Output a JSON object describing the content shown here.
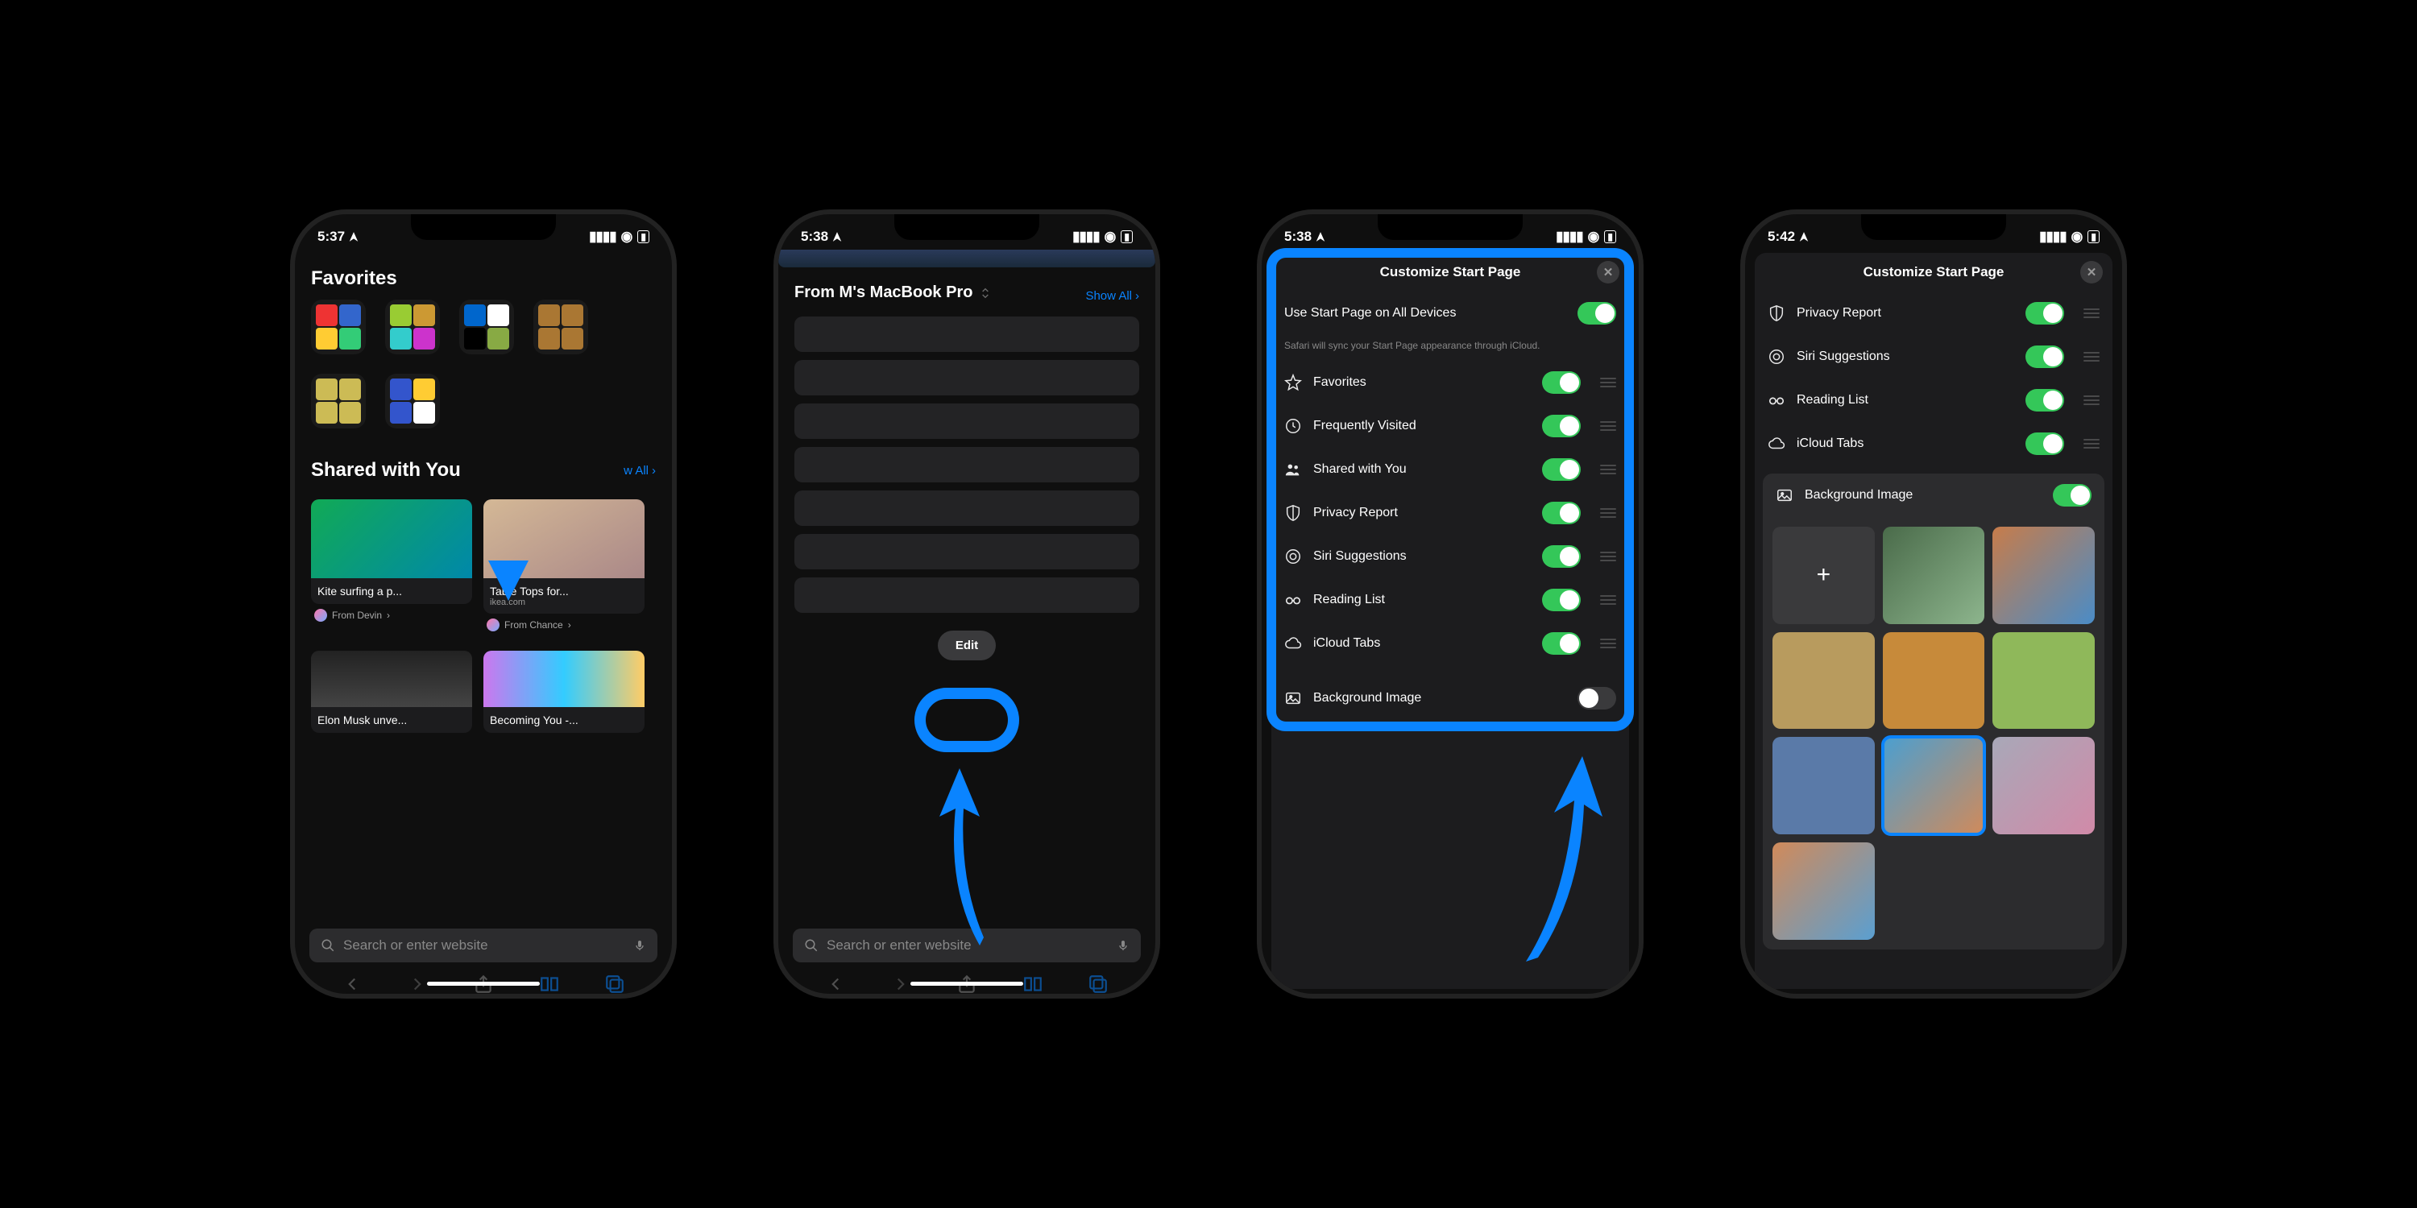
{
  "phones": {
    "p1": {
      "time": "5:37",
      "favorites_title": "Favorites",
      "shared_title": "Shared with You",
      "show_all": "w All",
      "cards": [
        {
          "title": "Kite surfing a p...",
          "sub": "",
          "from": "From Devin"
        },
        {
          "title": "Table Tops for...",
          "sub": "ikea.com",
          "from": "From Chance"
        },
        {
          "title": "Elon Musk unve...",
          "sub": "",
          "from": ""
        },
        {
          "title": "Becoming You -...",
          "sub": "",
          "from": ""
        }
      ],
      "search_placeholder": "Search or enter website"
    },
    "p2": {
      "time": "5:38",
      "header": "From M's MacBook Pro",
      "show_all": "Show All",
      "edit": "Edit",
      "search_placeholder": "Search or enter website"
    },
    "p3": {
      "time": "5:38",
      "modal_title": "Customize Start Page",
      "sync_label": "Use Start Page on All Devices",
      "sync_on": true,
      "sync_desc": "Safari will sync your Start Page appearance through iCloud.",
      "sections": [
        {
          "icon": "star",
          "label": "Favorites",
          "on": true
        },
        {
          "icon": "clock",
          "label": "Frequently Visited",
          "on": true
        },
        {
          "icon": "people",
          "label": "Shared with You",
          "on": true
        },
        {
          "icon": "shield",
          "label": "Privacy Report",
          "on": true
        },
        {
          "icon": "circles",
          "label": "Siri Suggestions",
          "on": true
        },
        {
          "icon": "glasses",
          "label": "Reading List",
          "on": true
        },
        {
          "icon": "cloud",
          "label": "iCloud Tabs",
          "on": true
        }
      ],
      "bg_label": "Background Image",
      "bg_on": false
    },
    "p4": {
      "time": "5:42",
      "modal_title": "Customize Start Page",
      "sections": [
        {
          "icon": "shield",
          "label": "Privacy Report",
          "on": true
        },
        {
          "icon": "circles",
          "label": "Siri Suggestions",
          "on": true
        },
        {
          "icon": "glasses",
          "label": "Reading List",
          "on": true
        },
        {
          "icon": "cloud",
          "label": "iCloud Tabs",
          "on": true
        }
      ],
      "bg_label": "Background Image",
      "bg_on": true,
      "bg_colors": [
        "add",
        "linear-gradient(135deg,#4a6b4a,#8db58d)",
        "linear-gradient(135deg,#c77c4a,#4a8cc7)",
        "#b89b5e",
        "#c78a3a",
        "#8fb85a",
        "#5a7aa8",
        "linear-gradient(135deg,#4a9fd1,#d18a5a)",
        "linear-gradient(135deg,#a8a8b8,#d18aa8)",
        "linear-gradient(135deg,#d18a5a,#5a9fd1)"
      ]
    }
  }
}
